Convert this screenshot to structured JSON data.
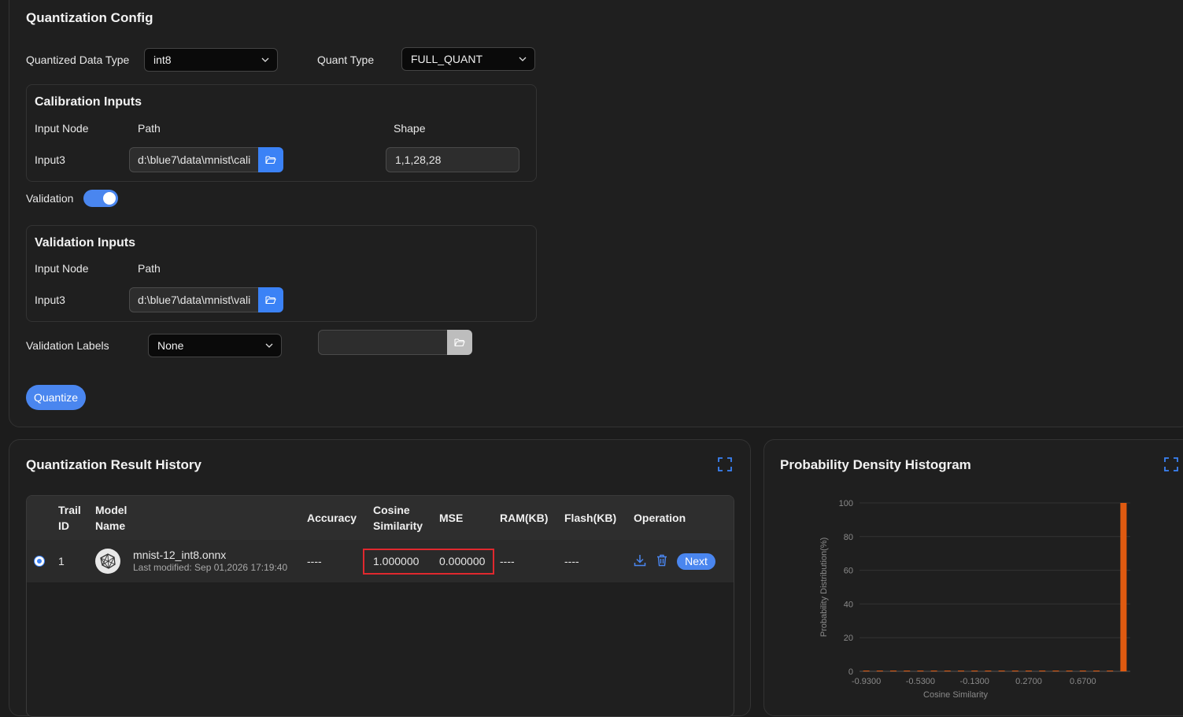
{
  "config": {
    "title": "Quantization Config",
    "quantized_data_type_label": "Quantized Data Type",
    "quantized_data_type_value": "int8",
    "quant_type_label": "Quant Type",
    "quant_type_value": "FULL_QUANT",
    "calibration": {
      "title": "Calibration Inputs",
      "col_input_node": "Input Node",
      "col_path": "Path",
      "col_shape": "Shape",
      "row_node": "Input3",
      "row_path": "d:\\blue7\\data\\mnist\\cali",
      "row_shape": "1,1,28,28"
    },
    "validation_label": "Validation",
    "validation_enabled": true,
    "validation_inputs": {
      "title": "Validation Inputs",
      "col_input_node": "Input Node",
      "col_path": "Path",
      "row_node": "Input3",
      "row_path": "d:\\blue7\\data\\mnist\\vali"
    },
    "validation_labels_label": "Validation Labels",
    "validation_labels_value": "None",
    "validation_labels_path": "",
    "quantize_button": "Quantize"
  },
  "history": {
    "title": "Quantization Result History",
    "columns": {
      "trail_id_1": "Trail",
      "trail_id_2": "ID",
      "model_1": "Model",
      "model_2": "Name",
      "accuracy": "Accuracy",
      "cosine_1": "Cosine",
      "cosine_2": "Similarity",
      "mse": "MSE",
      "ram": "RAM(KB)",
      "flash": "Flash(KB)",
      "operation": "Operation"
    },
    "rows": [
      {
        "selected": true,
        "id": "1",
        "model_name": "mnist-12_int8.onnx",
        "last_modified": "Last modified: Sep 01,2026 17:19:40",
        "accuracy": "----",
        "cosine": "1.000000",
        "mse": "0.000000",
        "ram": "----",
        "flash": "----",
        "next_button": "Next"
      }
    ]
  },
  "histogram": {
    "title": "Probability Density Histogram"
  },
  "chart_data": {
    "type": "bar",
    "title": "Probability Density Histogram",
    "xlabel": "Cosine  Similarity",
    "ylabel": "Probability Distribution(%)",
    "ylim": [
      0,
      100
    ],
    "yticks": [
      "0",
      "20",
      "40",
      "60",
      "80",
      "100"
    ],
    "xticks": [
      "-0.9300",
      "-0.5300",
      "-0.1300",
      "0.2700",
      "0.6700"
    ],
    "x": [
      -0.93,
      -0.83,
      -0.73,
      -0.63,
      -0.53,
      -0.43,
      -0.33,
      -0.23,
      -0.13,
      -0.03,
      0.07,
      0.17,
      0.27,
      0.37,
      0.47,
      0.57,
      0.67,
      0.77,
      0.87,
      0.97
    ],
    "values": [
      0,
      0,
      0,
      0,
      0,
      0,
      0,
      0,
      0,
      0,
      0,
      0,
      0,
      0,
      0,
      0,
      0,
      0,
      0,
      100
    ],
    "color": "#e05a10",
    "grid": true
  },
  "colors": {
    "accent": "#4a86ef",
    "highlight": "#e0282e",
    "bar": "#e05a10"
  }
}
